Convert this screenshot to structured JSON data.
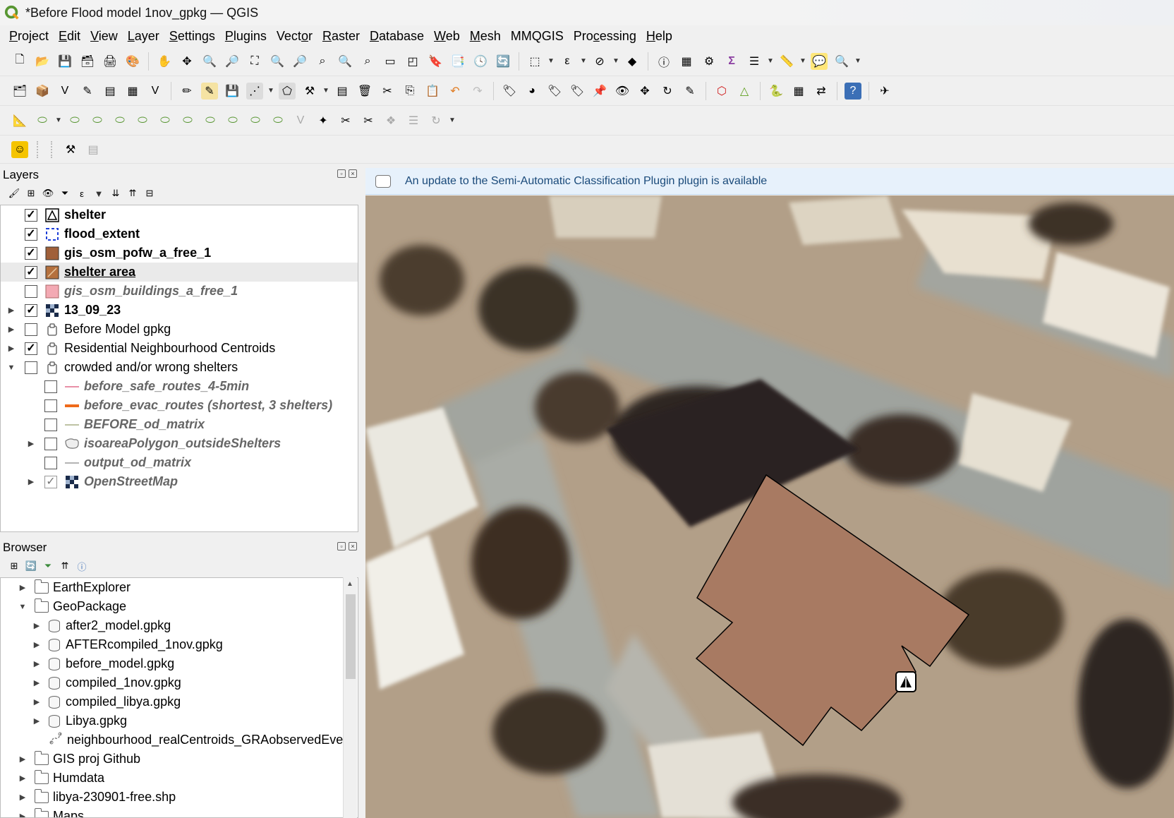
{
  "window": {
    "title": "*Before Flood model 1nov_gpkg — QGIS"
  },
  "menu": [
    {
      "pre": "",
      "u": "P",
      "post": "roject"
    },
    {
      "pre": "",
      "u": "E",
      "post": "dit"
    },
    {
      "pre": "",
      "u": "V",
      "post": "iew"
    },
    {
      "pre": "",
      "u": "L",
      "post": "ayer"
    },
    {
      "pre": "",
      "u": "S",
      "post": "ettings"
    },
    {
      "pre": "",
      "u": "P",
      "post": "lugins"
    },
    {
      "pre": "Vect",
      "u": "o",
      "post": "r"
    },
    {
      "pre": "",
      "u": "R",
      "post": "aster"
    },
    {
      "pre": "",
      "u": "D",
      "post": "atabase"
    },
    {
      "pre": "",
      "u": "W",
      "post": "eb"
    },
    {
      "pre": "",
      "u": "M",
      "post": "esh"
    },
    {
      "pre": "MMQGIS",
      "u": "",
      "post": ""
    },
    {
      "pre": "Pro",
      "u": "c",
      "post": "essing"
    },
    {
      "pre": "",
      "u": "H",
      "post": "elp"
    }
  ],
  "layers_panel": {
    "title": "Layers",
    "items": [
      {
        "label": "shelter",
        "checked": true,
        "style": "bold",
        "symbol": "shelter-point-icon"
      },
      {
        "label": "flood_extent",
        "checked": true,
        "style": "bold",
        "symbol": "dashed-polygon-icon"
      },
      {
        "label": "gis_osm_pofw_a_free_1",
        "checked": true,
        "style": "bold",
        "symbol": "brown-fill-icon"
      },
      {
        "label": "shelter area",
        "checked": true,
        "style": "underline",
        "symbol": "brown-pattern-icon"
      },
      {
        "label": "gis_osm_buildings_a_free_1",
        "checked": false,
        "style": "italic",
        "symbol": "pink-fill-icon"
      },
      {
        "label": "13_09_23",
        "checked": true,
        "style": "bold",
        "symbol": "raster-icon"
      },
      {
        "label": "Before Model gpkg",
        "checked": false,
        "style": "normal",
        "symbol": "group-icon"
      },
      {
        "label": "Residential Neighbourhood Centroids",
        "checked": true,
        "style": "normal",
        "symbol": "group-icon"
      },
      {
        "label": "crowded and/or wrong shelters",
        "checked": false,
        "style": "normal",
        "symbol": "group-icon"
      },
      {
        "label": "before_safe_routes_4-5min",
        "checked": false,
        "style": "italic",
        "symbol": "pink-line-icon"
      },
      {
        "label": "before_evac_routes (shortest, 3 shelters)",
        "checked": false,
        "style": "italic",
        "symbol": "orange-line-icon"
      },
      {
        "label": "BEFORE_od_matrix",
        "checked": false,
        "style": "italic",
        "symbol": "olive-line-icon"
      },
      {
        "label": "isoareaPolygon_outsideShelters",
        "checked": false,
        "style": "italic",
        "symbol": "grey-polygon-icon"
      },
      {
        "label": "output_od_matrix",
        "checked": false,
        "style": "italic",
        "symbol": "grey-line-icon"
      },
      {
        "label": "OpenStreetMap",
        "checked": true,
        "style": "italic-grey",
        "symbol": "raster-icon"
      }
    ]
  },
  "browser_panel": {
    "title": "Browser",
    "items": [
      {
        "label": "EarthExplorer",
        "kind": "folder"
      },
      {
        "label": "GeoPackage",
        "kind": "folder"
      },
      {
        "label": "after2_model.gpkg",
        "kind": "db"
      },
      {
        "label": "AFTERcompiled_1nov.gpkg",
        "kind": "db"
      },
      {
        "label": "before_model.gpkg",
        "kind": "db"
      },
      {
        "label": "compiled_1nov.gpkg",
        "kind": "db"
      },
      {
        "label": "compiled_libya.gpkg",
        "kind": "db"
      },
      {
        "label": "Libya.gpkg",
        "kind": "db"
      },
      {
        "label": "neighbourhood_realCentroids_GRAobservedEvent",
        "kind": "vector"
      },
      {
        "label": "GIS proj Github",
        "kind": "folder"
      },
      {
        "label": "Humdata",
        "kind": "folder"
      },
      {
        "label": "libya-230901-free.shp",
        "kind": "folder"
      },
      {
        "label": "Maps",
        "kind": "folder"
      }
    ]
  },
  "message_bar": {
    "text": "An update to the Semi-Automatic Classification Plugin plugin is available"
  },
  "colors": {
    "polygon_fill": "#a87a62",
    "accent": "#589632"
  }
}
